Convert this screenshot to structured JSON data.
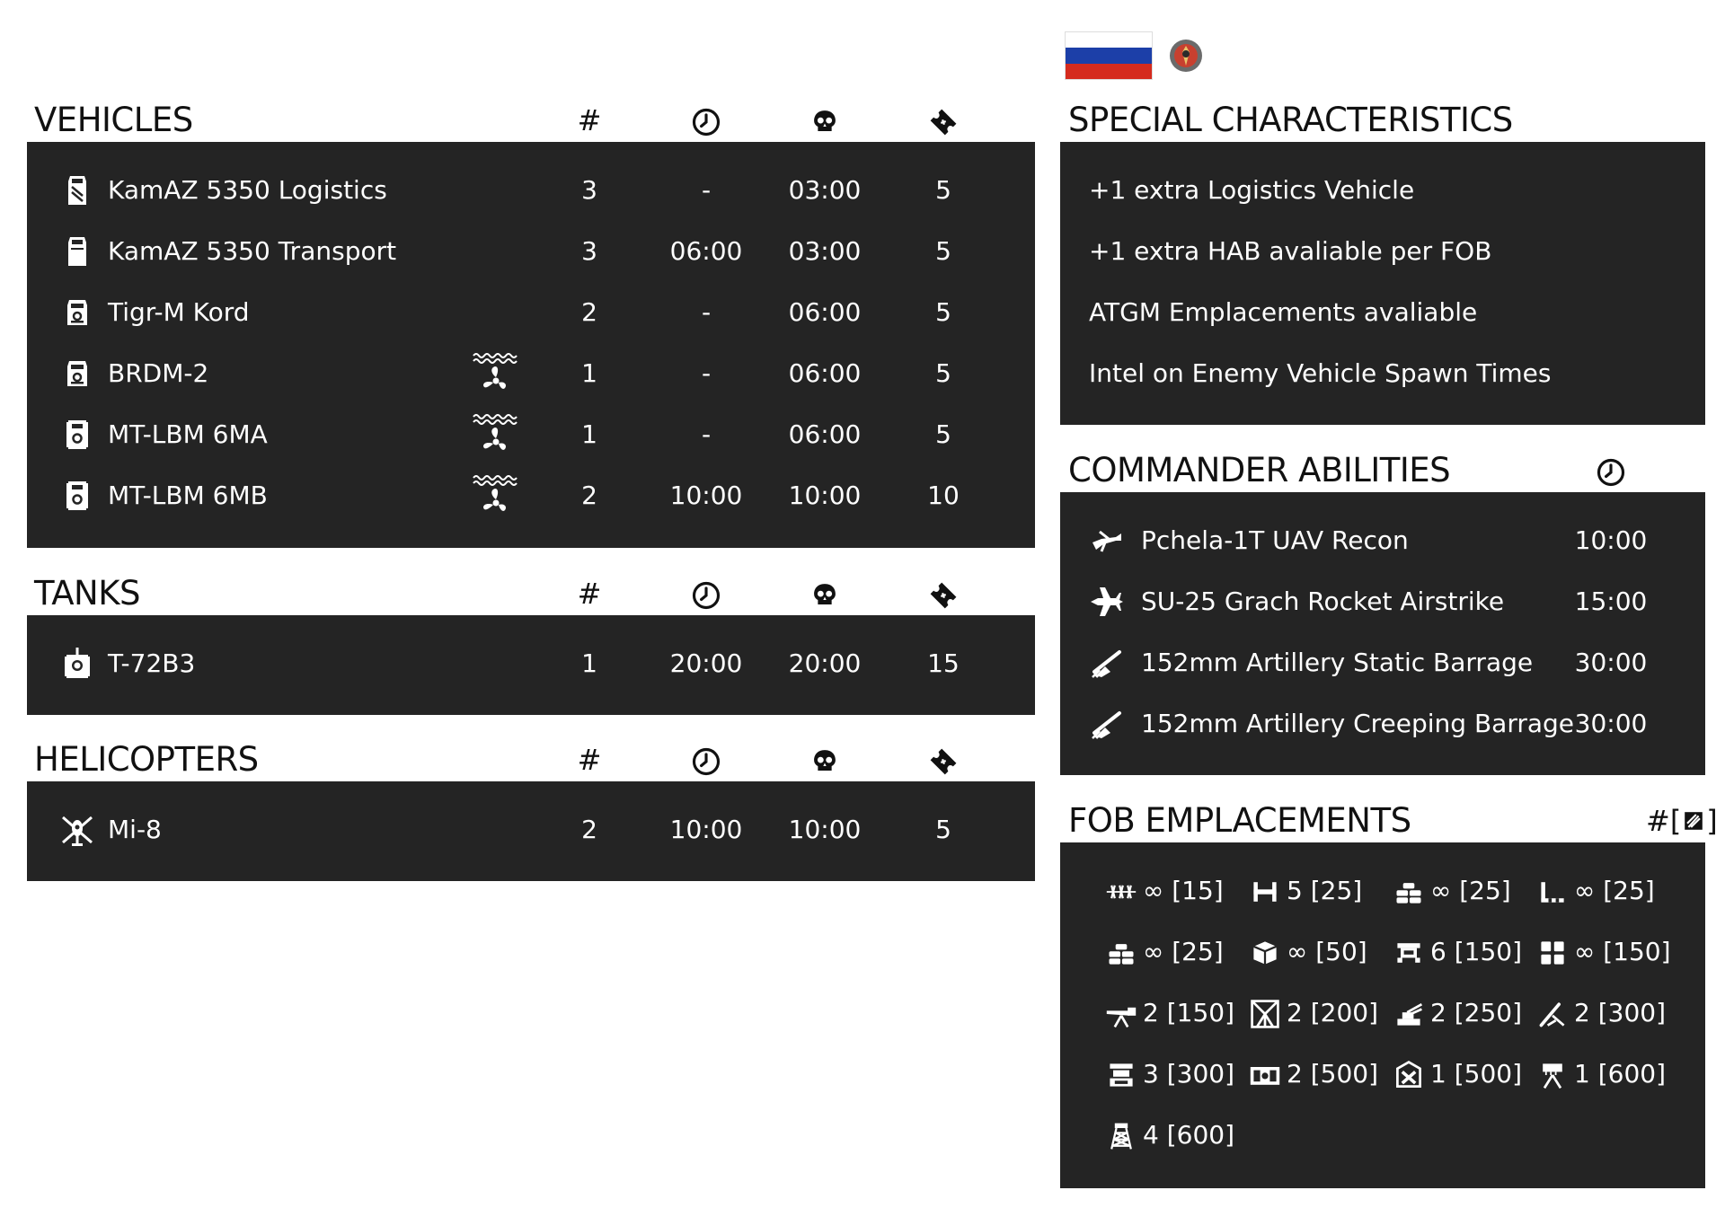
{
  "header": {
    "flag_colors": [
      "#ffffff",
      "#1c3fa8",
      "#d52b1e"
    ],
    "emblem_icon": "faction-emblem-icon"
  },
  "columns": {
    "count": "#",
    "respawn_icon": "clock-icon",
    "delay_icon": "skull-icon",
    "tickets_icon": "ticket-icon"
  },
  "vehicles": {
    "title": "VEHICLES",
    "rows": [
      {
        "name": "KamAZ 5350 Logistics",
        "icon": "logistics-truck-icon",
        "amphibious": false,
        "count": "3",
        "respawn": "-",
        "delay": "03:00",
        "tickets": "5"
      },
      {
        "name": "KamAZ 5350 Transport",
        "icon": "transport-truck-icon",
        "amphibious": false,
        "count": "3",
        "respawn": "06:00",
        "delay": "03:00",
        "tickets": "5"
      },
      {
        "name": "Tigr-M Kord",
        "icon": "armored-car-icon",
        "amphibious": false,
        "count": "2",
        "respawn": "-",
        "delay": "06:00",
        "tickets": "5"
      },
      {
        "name": "BRDM-2",
        "icon": "armored-car-icon",
        "amphibious": true,
        "count": "1",
        "respawn": "-",
        "delay": "06:00",
        "tickets": "5"
      },
      {
        "name": "MT-LBM 6MA",
        "icon": "apc-icon",
        "amphibious": true,
        "count": "1",
        "respawn": "-",
        "delay": "06:00",
        "tickets": "5"
      },
      {
        "name": "MT-LBM 6MB",
        "icon": "apc-icon",
        "amphibious": true,
        "count": "2",
        "respawn": "10:00",
        "delay": "10:00",
        "tickets": "10"
      }
    ]
  },
  "tanks": {
    "title": "TANKS",
    "rows": [
      {
        "name": "T-72B3",
        "icon": "tank-icon",
        "count": "1",
        "respawn": "20:00",
        "delay": "20:00",
        "tickets": "15"
      }
    ]
  },
  "helicopters": {
    "title": "HELICOPTERS",
    "rows": [
      {
        "name": "Mi-8",
        "icon": "helicopter-icon",
        "count": "2",
        "respawn": "10:00",
        "delay": "10:00",
        "tickets": "5"
      }
    ]
  },
  "special": {
    "title": "SPECIAL CHARACTERISTICS",
    "items": [
      "+1 extra Logistics Vehicle",
      "+1 extra HAB avaliable per FOB",
      "ATGM Emplacements avaliable",
      "Intel on Enemy Vehicle Spawn Times"
    ]
  },
  "commander": {
    "title": "COMMANDER ABILITIES",
    "header_icon": "clock-icon",
    "items": [
      {
        "name": "Pchela-1T UAV Recon",
        "icon": "uav-icon",
        "time": "10:00"
      },
      {
        "name": "SU-25 Grach Rocket Airstrike",
        "icon": "jet-icon",
        "time": "15:00"
      },
      {
        "name": "152mm Artillery Static Barrage",
        "icon": "artillery-icon",
        "time": "30:00"
      },
      {
        "name": "152mm Artillery Creeping Barrage",
        "icon": "artillery-icon",
        "time": "30:00"
      }
    ]
  },
  "fob": {
    "title": "FOB EMPLACEMENTS",
    "header_label": "#[",
    "header_label_end": "]",
    "header_icon": "construction-icon",
    "items": [
      {
        "icon": "razor-wire-icon",
        "label": "∞ [15]"
      },
      {
        "icon": "hesco-icon",
        "label": "5 [25]"
      },
      {
        "icon": "sandbag-icon",
        "label": "∞ [25]"
      },
      {
        "icon": "barrier-icon",
        "label": "∞ [25]"
      },
      {
        "icon": "sandbag-wall-icon",
        "label": "∞ [25]"
      },
      {
        "icon": "ammo-crate-icon",
        "label": "∞ [50]"
      },
      {
        "icon": "bunker-icon",
        "label": "6 [150]"
      },
      {
        "icon": "hesco-block-icon",
        "label": "∞ [150]"
      },
      {
        "icon": "hmg-icon",
        "label": "2 [150]"
      },
      {
        "icon": "atgm-icon",
        "label": "2 [200]"
      },
      {
        "icon": "aa-gun-icon",
        "label": "2 [250]"
      },
      {
        "icon": "mortar-icon",
        "label": "2 [300]"
      },
      {
        "icon": "repair-station-icon",
        "label": "3 [300]"
      },
      {
        "icon": "ammo-cache-icon",
        "label": "2 [500]"
      },
      {
        "icon": "hab-icon",
        "label": "1 [500]"
      },
      {
        "icon": "rocket-launcher-icon",
        "label": "1 [600]"
      },
      {
        "icon": "watchtower-icon",
        "label": "4 [600]"
      }
    ]
  }
}
